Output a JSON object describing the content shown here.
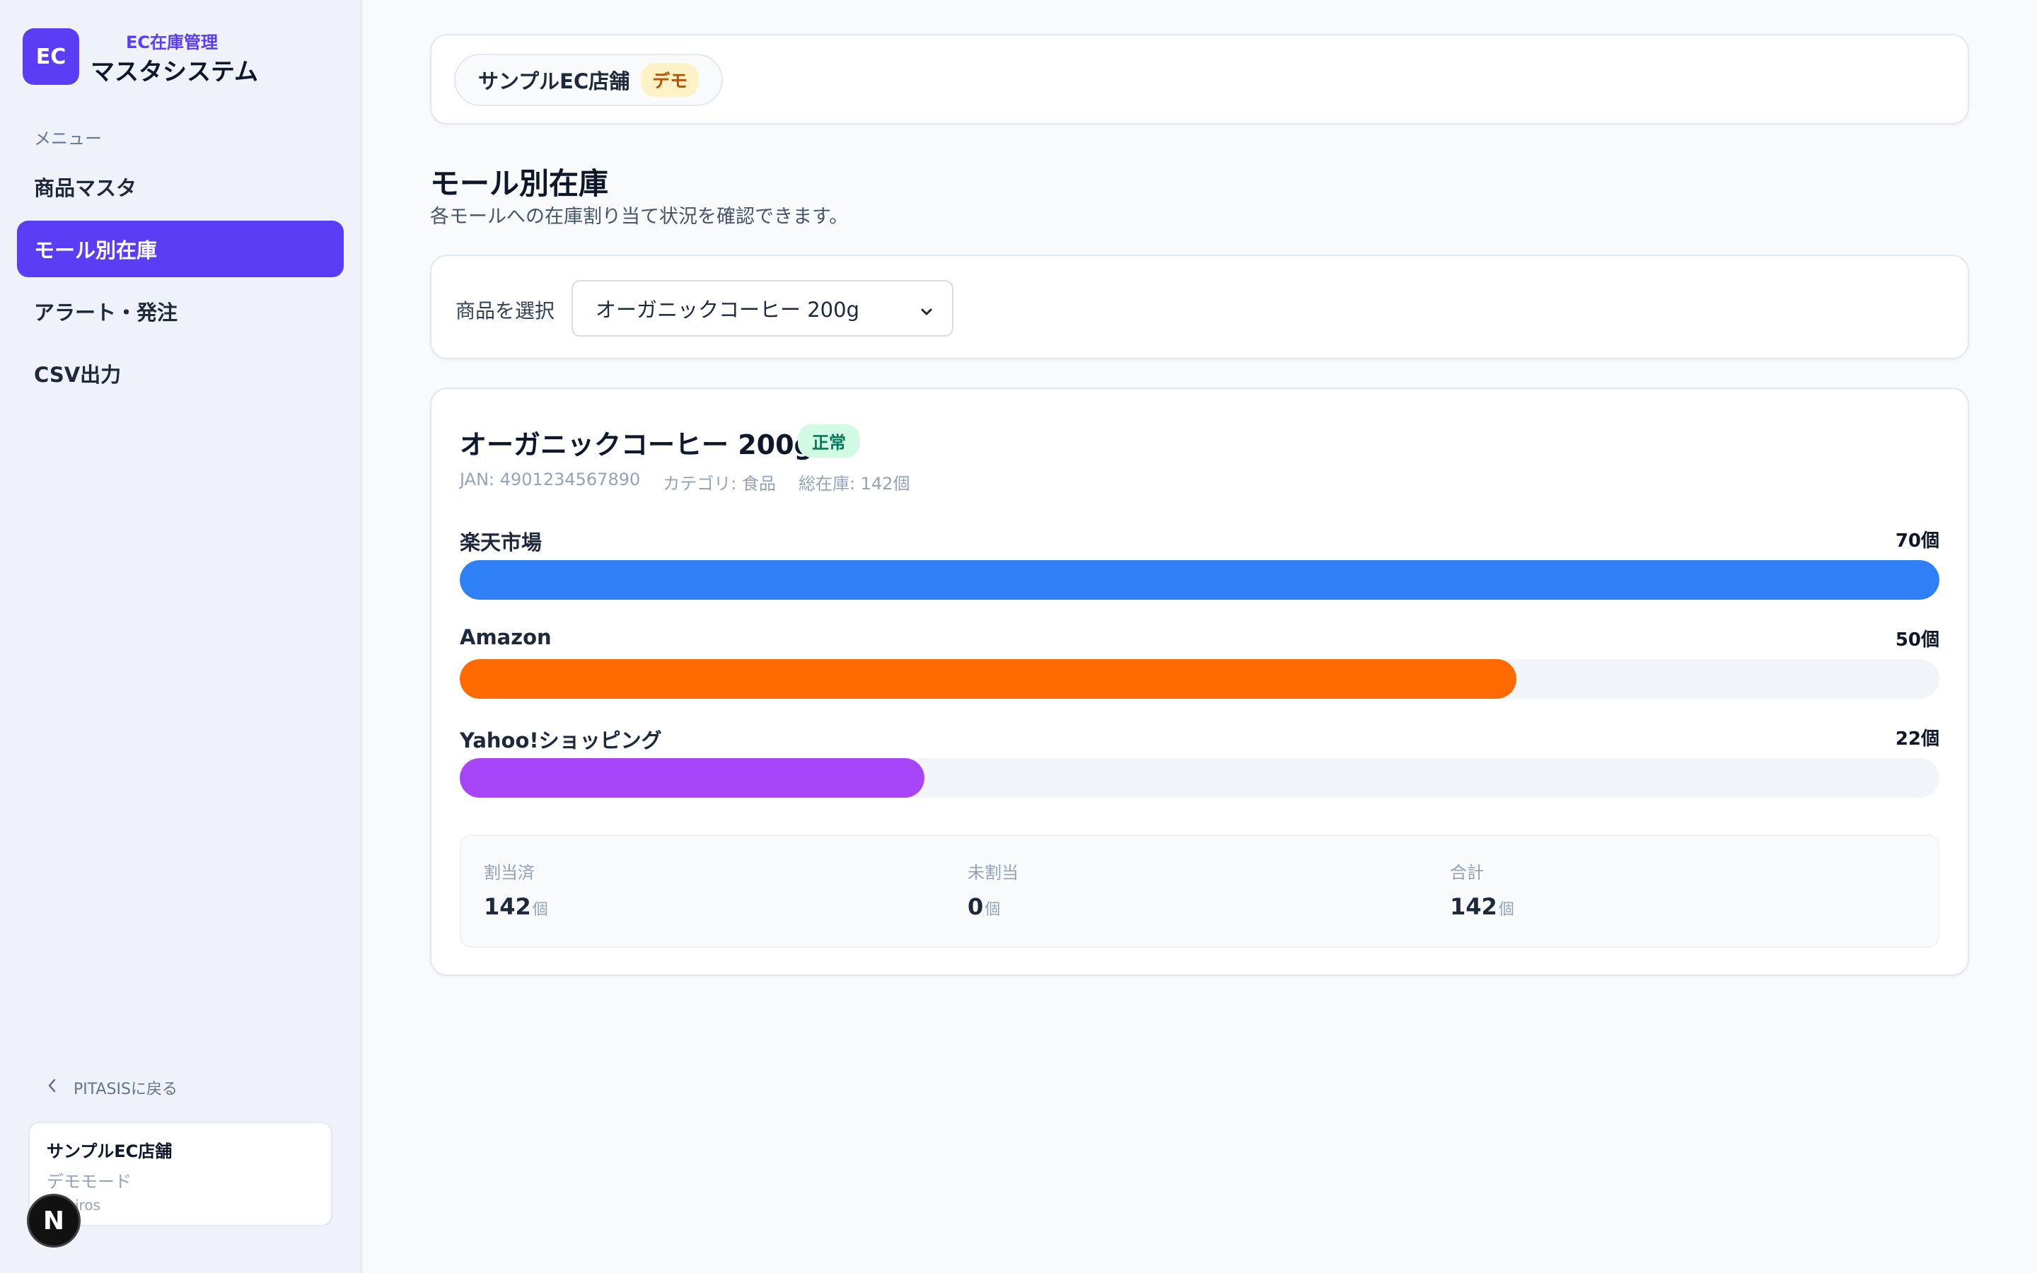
{
  "sidebar": {
    "logo": "EC",
    "brand_sub": "EC在庫管理",
    "brand_main": "マスタシステム",
    "menu_label": "メニュー",
    "items": [
      {
        "label": "商品マスタ"
      },
      {
        "label": "モール別在庫"
      },
      {
        "label": "アラート・発注"
      },
      {
        "label": "CSV出力"
      }
    ],
    "active_index": 1,
    "back_link": "PITASISに戻る",
    "store": {
      "name": "サンプルEC店舗",
      "mode": "デモモード",
      "plan": "iros"
    },
    "n_badge": "N"
  },
  "header": {
    "store_name": "サンプルEC店舗",
    "demo_badge": "デモ"
  },
  "page": {
    "title": "モール別在庫",
    "subtitle": "各モールへの在庫割り当て状況を確認できます。"
  },
  "selector": {
    "label": "商品を選択",
    "selected": "オーガニックコーヒー 200g"
  },
  "product": {
    "name": "オーガニックコーヒー 200g",
    "status": "正常",
    "jan": "JAN: 4901234567890",
    "category": "カテゴリ: 食品",
    "total": "総在庫: 142個",
    "total_stock": 142,
    "malls": [
      {
        "name": "楽天市場",
        "qty_label": "70個",
        "qty": 70,
        "fill_fraction": 1.0,
        "color": "#2f80f7"
      },
      {
        "name": "Amazon",
        "qty_label": "50個",
        "qty": 50,
        "fill_fraction": 0.714,
        "color": "#ff6a00"
      },
      {
        "name": "Yahoo!ショッピング",
        "qty_label": "22個",
        "qty": 22,
        "fill_fraction": 0.314,
        "color": "#a745fb"
      }
    ]
  },
  "summary": {
    "allocated": {
      "label": "割当済",
      "value": "142",
      "unit": "個"
    },
    "unallocated": {
      "label": "未割当",
      "value": "0",
      "unit": "個"
    },
    "total": {
      "label": "合計",
      "value": "142",
      "unit": "個"
    }
  },
  "colors": {
    "accent": "#5b3df5",
    "status_ok": "#047857"
  }
}
